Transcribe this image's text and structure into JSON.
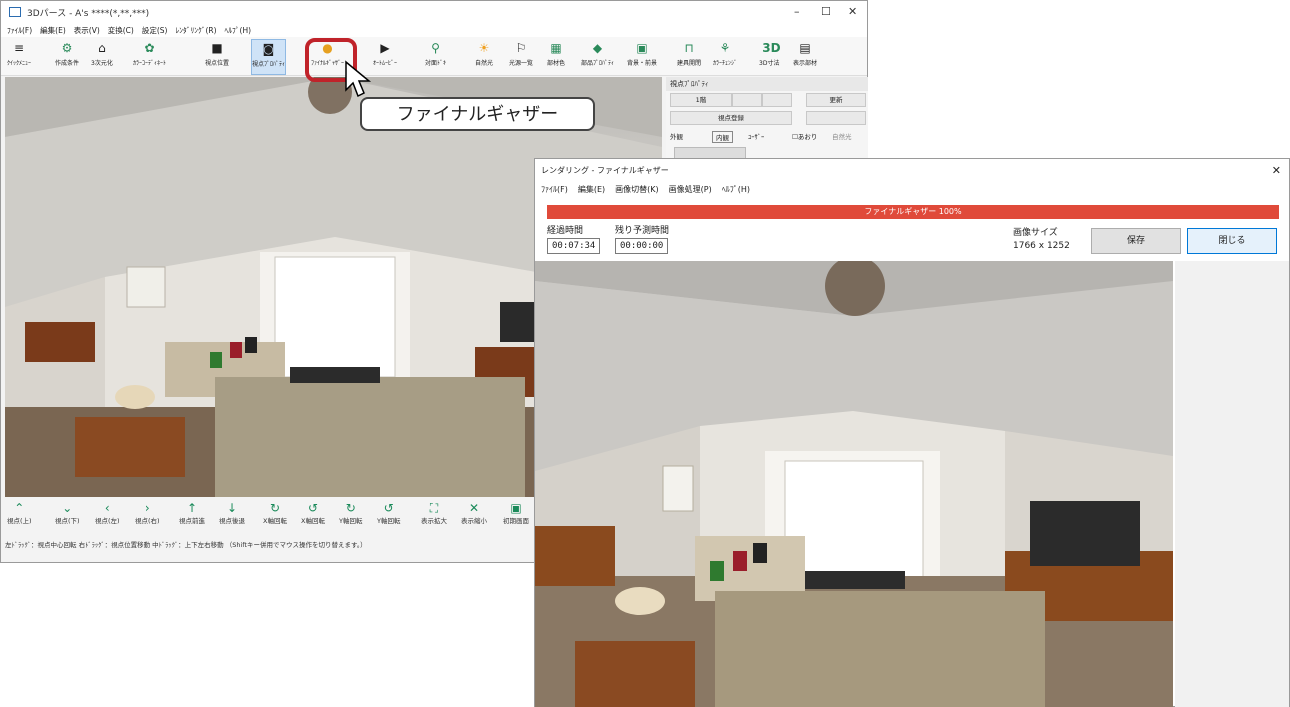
{
  "main_window": {
    "title": "3Dパース - A's ****(*,**,***)",
    "controls": {
      "minimize": "–",
      "maximize": "☐",
      "close": "✕"
    },
    "menu": [
      "ﾌｧｲﾙ(F)",
      "編集(E)",
      "表示(V)",
      "変換(C)",
      "設定(S)",
      "ﾚﾝﾀﾞﾘﾝｸﾞ(R)",
      "ﾍﾙﾌﾟ(H)"
    ],
    "toolbar": [
      {
        "label": "ｸｲｯｸﾒﾆｭｰ",
        "icon": "menu-icon"
      },
      {
        "label": "作成条件",
        "icon": "conditions-icon"
      },
      {
        "label": "3次元化",
        "icon": "3d-convert-icon"
      },
      {
        "label": "ｶﾗｰｺｰﾃﾞｨﾈｰﾄ",
        "icon": "color-coordinate-icon"
      },
      {
        "label": "視点位置",
        "icon": "camera-icon"
      },
      {
        "label": "視点ﾌﾟﾛﾊﾟﾃｨ",
        "icon": "camera-property-icon"
      },
      {
        "label": "ﾌｧｲﾅﾙｷﾞｬｻﾞｰ",
        "icon": "final-gather-icon"
      },
      {
        "label": "ｵｰﾄﾑｰﾋﾞｰ",
        "icon": "movie-icon"
      },
      {
        "label": "対面ﾄﾞｷ",
        "icon": "face-icon"
      },
      {
        "label": "自然光",
        "icon": "sun-icon"
      },
      {
        "label": "光源一覧",
        "icon": "light-list-icon"
      },
      {
        "label": "部材色",
        "icon": "material-color-icon"
      },
      {
        "label": "部品ﾌﾟﾛﾊﾟﾃｨ",
        "icon": "part-property-icon"
      },
      {
        "label": "背景・前景",
        "icon": "background-icon"
      },
      {
        "label": "建具開閉",
        "icon": "door-icon"
      },
      {
        "label": "ｶﾗｰﾁｪﾝｼﾞ",
        "icon": "color-change-icon"
      },
      {
        "label": "3D寸法",
        "icon": "3d-dimension-icon"
      },
      {
        "label": "表示部材",
        "icon": "display-parts-icon"
      }
    ],
    "side_panel": {
      "header": "視点ﾌﾟﾛﾊﾟﾃｨ",
      "floor_button": "1階",
      "update_button": "更新",
      "register_button": "視点登録",
      "tabs": [
        "外観",
        "内観",
        "ﾕｰｻﾞｰ"
      ],
      "checkbox_label": "あおり",
      "natural_light_label": "自然光"
    },
    "bottom_buttons": [
      {
        "label": "視点(上)",
        "icon": "arrow-up-icon"
      },
      {
        "label": "視点(下)",
        "icon": "arrow-down-icon"
      },
      {
        "label": "視点(左)",
        "icon": "arrow-left-icon"
      },
      {
        "label": "視点(右)",
        "icon": "arrow-right-icon"
      },
      {
        "label": "視点前進",
        "icon": "forward-icon"
      },
      {
        "label": "視点後退",
        "icon": "backward-icon"
      },
      {
        "label": "X軸回転",
        "icon": "x-rotate-icon"
      },
      {
        "label": "X軸回転",
        "icon": "x-rotate-reverse-icon"
      },
      {
        "label": "Y軸回転",
        "icon": "y-rotate-icon"
      },
      {
        "label": "Y軸回転",
        "icon": "y-rotate-reverse-icon"
      },
      {
        "label": "表示拡大",
        "icon": "zoom-in-icon"
      },
      {
        "label": "表示縮小",
        "icon": "zoom-out-icon"
      },
      {
        "label": "初期画面",
        "icon": "home-icon"
      }
    ],
    "hint": "左ﾄﾞﾗｯｸﾞ：視点中心回転  右ﾄﾞﾗｯｸﾞ：視点位置移動  中ﾄﾞﾗｯｸﾞ：上下左右移動  （Shiftキー併用でマウス操作を切り替えます。）"
  },
  "callout": {
    "text": "ファイナルギャザー"
  },
  "render_window": {
    "title": "レンダリング - ファイナルギャザー",
    "close": "✕",
    "menu": [
      "ﾌｧｲﾙ(F)",
      "編集(E)",
      "画像切替(K)",
      "画像処理(P)",
      "ﾍﾙﾌﾟ(H)"
    ],
    "progress_label": "ファイナルギャザー 100%",
    "progress_value": 1.0,
    "elapsed_label": "経過時間",
    "elapsed_value": "00:07:34",
    "remaining_label": "残り予測時間",
    "remaining_value": "00:00:00",
    "size_label": "画像サイズ",
    "size_value": "1766 x 1252",
    "save_button": "保存",
    "close_button": "閉じる"
  }
}
